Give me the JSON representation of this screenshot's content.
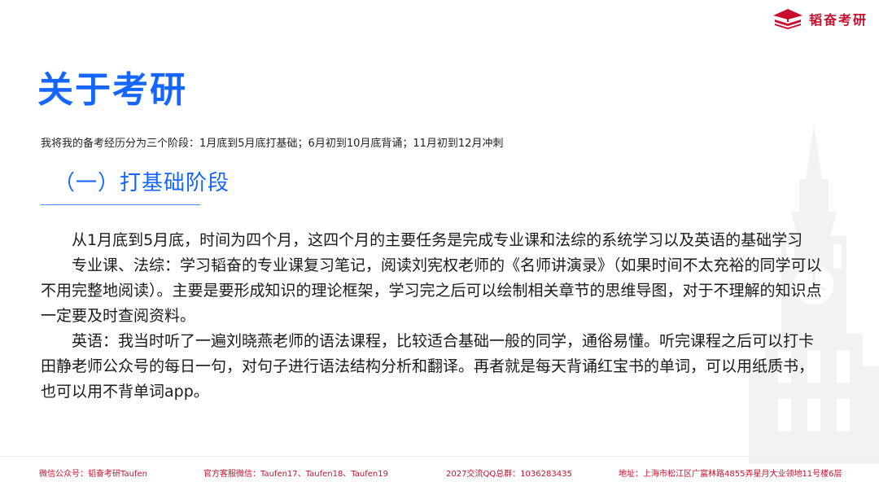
{
  "brand": {
    "name": "韬奋考研",
    "icon": "book-stack-logo-icon"
  },
  "title": "关于考研",
  "intro": "我将我的备考经历分为三个阶段：1月底到5月底打基础；6月初到10月底背诵；11月初到12月冲刺",
  "section_heading": "（一）打基础阶段",
  "paragraphs": [
    "从1月底到5月底，时间为四个月，这四个月的主要任务是完成专业课和法综的系统学习以及英语的基础学习",
    "专业课、法综：学习韬奋的专业课复习笔记，阅读刘宪权老师的《名师讲演录》（如果时间不太充裕的同学可以不用完整地阅读）。主要是要形成知识的理论框架，学习完之后可以绘制相关章节的思维导图，对于不理解的知识点一定要及时查阅资料。",
    "英语：我当时听了一遍刘晓燕老师的语法课程，比较适合基础一般的同学，通俗易懂。听完课程之后可以打卡田静老师公众号的每日一句，对句子进行语法结构分析和翻译。再者就是每天背诵红宝书的单词，可以用纸质书，也可以用不背单词app。"
  ],
  "footer": {
    "wechat": "微信公众号：韬奋考研Taufen",
    "service": "官方客服微信：Taufen17、Taufen18、Taufen19",
    "qq": "2027交流QQ总群：1036283435",
    "address": "地址：上海市松江区广富林路4855弄星月大业领地11号楼6层"
  },
  "colors": {
    "accent": "#1565ff",
    "brand": "#c8102e",
    "text": "#1a1a1a"
  }
}
